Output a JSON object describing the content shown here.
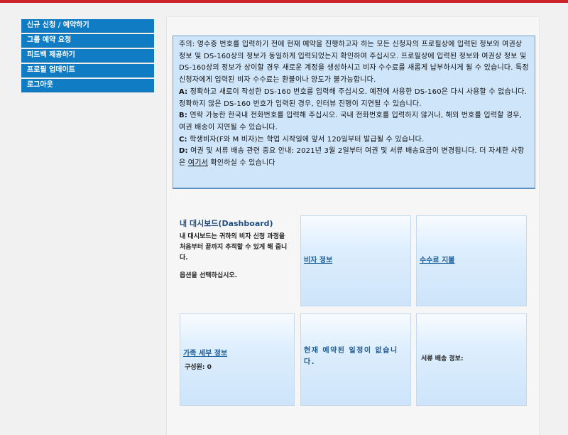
{
  "colors": {
    "topbar": "#cc2229",
    "sidebar_bg": "#0f7cc4",
    "notice_bg": "#cfe5fa",
    "link": "#1d5f99"
  },
  "sidebar": {
    "items": [
      {
        "label": "신규 신청 / 예약하기"
      },
      {
        "label": "그룹 예약 요청"
      },
      {
        "label": "피드백 제공하기"
      },
      {
        "label": "프로필 업데이트"
      },
      {
        "label": "로그아웃"
      }
    ]
  },
  "notice": {
    "intro": "주의: 영수증 번호를 입력하기 전에 현재 예약을 진행하고자 하는 모든 신청자의 프로필상에 입력된 정보와 여권상 정보 및 DS-160상의 정보가 동일하게 입력되었는지 확인하여 주십시오. 프로필상에 입력된 정보와 여권상 정보 및 DS-160상의 정보가 상이할 경우 새로운 계정을 생성하시고 비자 수수료를 새롭게 납부하시게 될 수 있습니다. 특정 신청자에게 입력된 비자 수수료는 환불이나 양도가 불가능합니다.",
    "a_label": "A:",
    "a_text": "정확하고 새로이 작성한 DS-160 번호를 입력해 주십시오. 예전에 사용한 DS-160은 다시 사용할 수 없습니다. 정확하지 않은 DS-160 번호가 입력된 경우, 인터뷰 진행이 지연될 수 있습니다.",
    "b_label": "B:",
    "b_text": "연락 가능한 한국내 전화번호를 입력해 주십시오. 국내 전화번호를 입력하지 않거나, 해외 번호를 입력할 경우, 여권 배송이 지연될 수 있습니다.",
    "c_label": "C:",
    "c_text": "학생비자(F와 M 비자)는 학업 시작일에 앞서 120일부터 발급될 수 있습니다.",
    "d_label": "D:",
    "d_text": "여권 및 서류 배송 관련 중요 안내: 2021년 3월 2일부터 여권 및 서류 배송요금이 변경됩니다. 더 자세한 사항은",
    "d_link": "여기서",
    "d_tail": "확인하실 수 있습니다"
  },
  "dashboard": {
    "title": "내 대시보드(Dashboard)",
    "description": "내 대시보드는 귀하의 비자 신청 과정을 처음부터 끝까지 추적할 수 있게 해 줍니다.",
    "prompt": "옵션을 선택하십시오.",
    "visa_info_link": "비자 정보",
    "fee_payment_link": "수수료 지불",
    "family_info_link": "가족 세부 정보",
    "members_label": "구성원: 0",
    "no_appointment": "현재 예약된 일정이 없습니다.",
    "delivery_label": "서류 배송 정보:"
  }
}
